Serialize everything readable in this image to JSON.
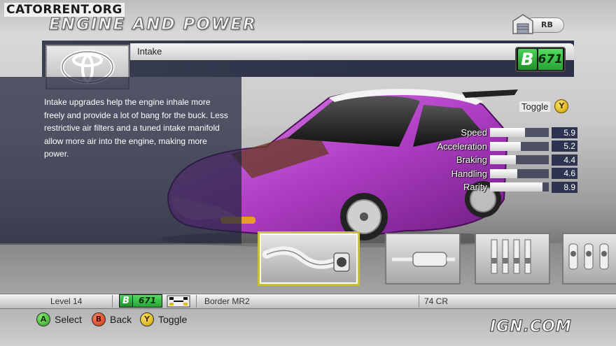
{
  "watermark": "CATORRENT.ORG",
  "header": {
    "title": "Engine and Power",
    "rb_label": "RB"
  },
  "part": {
    "name": "Intake",
    "brand_logo": "toyota-logo",
    "class_letter": "B",
    "class_rating": "671",
    "description": "Intake upgrades help the engine inhale more freely and provide a lot of bang for the buck. Less restrictive air filters and a tuned intake manifold allow more air into the engine, making more power."
  },
  "stats": {
    "toggle_label": "Toggle",
    "toggle_button": "Y",
    "items": [
      {
        "label": "Speed",
        "value": "5.9",
        "level": 0.59
      },
      {
        "label": "Acceleration",
        "value": "5.2",
        "level": 0.52
      },
      {
        "label": "Braking",
        "value": "4.4",
        "level": 0.44
      },
      {
        "label": "Handling",
        "value": "4.6",
        "level": 0.46
      },
      {
        "label": "Rarity",
        "value": "8.9",
        "level": 0.89
      }
    ]
  },
  "parts_carousel": [
    {
      "name": "intake-pipe-icon",
      "selected": true
    },
    {
      "name": "exhaust-muffler-icon",
      "selected": false
    },
    {
      "name": "spark-plugs-icon",
      "selected": false
    },
    {
      "name": "injectors-icon",
      "selected": false
    }
  ],
  "status_bar": {
    "level": "Level 14",
    "class_letter": "B",
    "class_rating": "671",
    "car_name": "Border MR2",
    "credits": "74 CR"
  },
  "legend": [
    {
      "button": "A",
      "label": "Select"
    },
    {
      "button": "B",
      "label": "Back"
    },
    {
      "button": "Y",
      "label": "Toggle"
    }
  ],
  "ign_logo": "IGN.COM",
  "colors": {
    "panel_dark": "#2c3148",
    "class_green": "#26a335",
    "car_purple": "#b23fc7",
    "selected_border": "#c8c232"
  }
}
